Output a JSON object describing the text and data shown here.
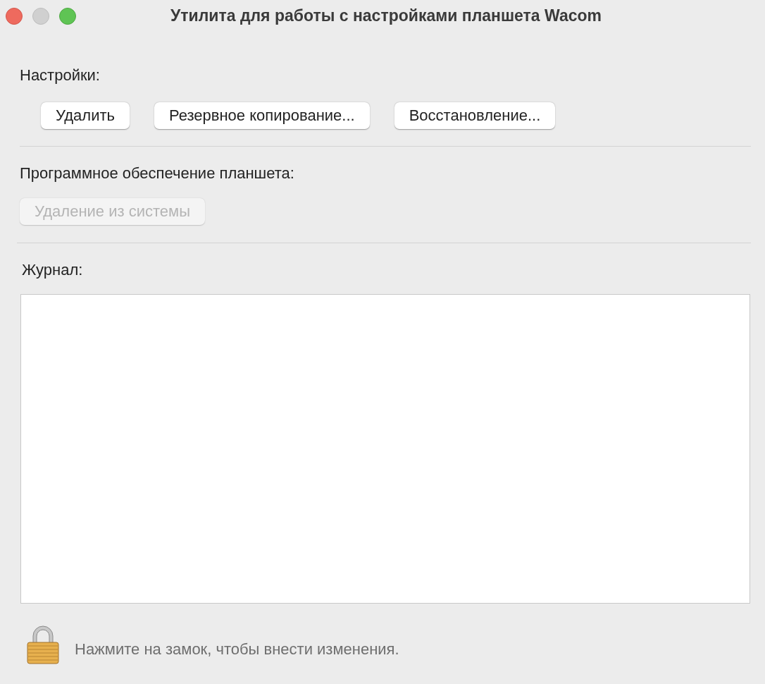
{
  "window": {
    "title": "Утилита для работы с настройками планшета Wacom"
  },
  "settings": {
    "label": "Настройки:",
    "buttons": [
      {
        "label": "Удалить",
        "disabled": false
      },
      {
        "label": "Резервное копирование...",
        "disabled": false
      },
      {
        "label": "Восстановление...",
        "disabled": false
      }
    ]
  },
  "software": {
    "label": "Программное обеспечение планшета:",
    "buttons": [
      {
        "label": "Удаление из системы",
        "disabled": true
      }
    ]
  },
  "log": {
    "label": "Журнал:"
  },
  "lock": {
    "hint": "Нажмите на замок, чтобы внести изменения."
  }
}
